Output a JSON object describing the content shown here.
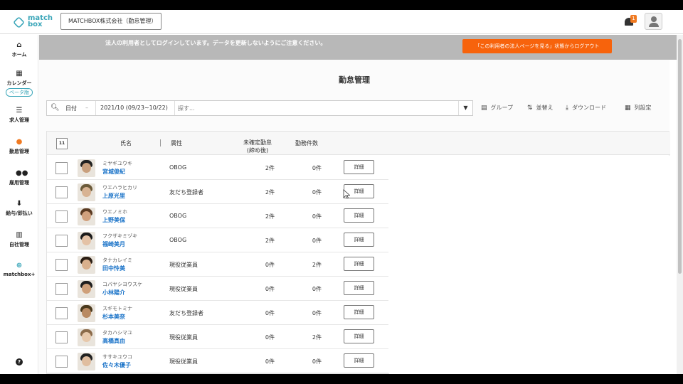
{
  "header": {
    "logo_text": "match\nbox",
    "company": "MATCHBOX株式会社（勤怠管理）",
    "notification_count": "1"
  },
  "sidebar": {
    "items": [
      {
        "icon": "home-icon",
        "label": "ホーム"
      },
      {
        "icon": "calendar-icon",
        "label": "カレンダー",
        "badge": "ベータ版"
      },
      {
        "icon": "list-icon",
        "label": "求人管理"
      },
      {
        "icon": "attendance-icon",
        "label": "勤怠管理"
      },
      {
        "icon": "people-icon",
        "label": "雇用管理"
      },
      {
        "icon": "payment-icon",
        "label": "給与/即払い"
      },
      {
        "icon": "building-icon",
        "label": "自社管理"
      },
      {
        "icon": "plus-circle-icon",
        "label": "matchbox+"
      }
    ],
    "help": "?"
  },
  "notice": {
    "text": "法人の利用者としてログインしています。データを更新しないようにご注意ください。",
    "button": "「この利用者の法人ページを見る」状態からログアウト"
  },
  "page": {
    "title": "勤怠管理"
  },
  "search": {
    "date_label": "日付",
    "date_value": "2021/10 (09/23~10/22)",
    "placeholder": "探す..."
  },
  "toolbar": {
    "group": "グループ",
    "sort": "並替え",
    "download": "ダウンロード",
    "columns": "列設定"
  },
  "table": {
    "select_count": "11",
    "headers": {
      "name": "氏名",
      "attribute": "属性",
      "pending": "未確定勤怠\n(締め後)",
      "count": "勤務件数"
    },
    "detail_label": "詳細",
    "rows": [
      {
        "kana": "ミヤギユウキ",
        "name": "宮城俊紀",
        "attribute": "OBOG",
        "pending": "2件",
        "count": "0件",
        "hair": "#222",
        "skin": "#c9a07e"
      },
      {
        "kana": "ウエハラヒカリ",
        "name": "上原光里",
        "attribute": "友だち登録者",
        "pending": "2件",
        "count": "0件",
        "hair": "#6b5a3a",
        "skin": "#d8b393"
      },
      {
        "kana": "ウエノミホ",
        "name": "上野美保",
        "attribute": "OBOG",
        "pending": "2件",
        "count": "0件",
        "hair": "#5a3a22",
        "skin": "#d1a17e"
      },
      {
        "kana": "フクザキミヅキ",
        "name": "福崎美月",
        "attribute": "OBOG",
        "pending": "2件",
        "count": "0件",
        "hair": "#1b1b1b",
        "skin": "#e4c2a6"
      },
      {
        "kana": "タナカレイミ",
        "name": "田中怜美",
        "attribute": "現役従業員",
        "pending": "0件",
        "count": "2件",
        "hair": "#2b1e14",
        "skin": "#d9b08d"
      },
      {
        "kana": "コバヤシヨウスケ",
        "name": "小林陽介",
        "attribute": "現役従業員",
        "pending": "0件",
        "count": "0件",
        "hair": "#1e1e1e",
        "skin": "#cfa07a"
      },
      {
        "kana": "スギモトミナ",
        "name": "杉本美奈",
        "attribute": "友だち登録者",
        "pending": "0件",
        "count": "0件",
        "hair": "#4a3a1e",
        "skin": "#b98a62"
      },
      {
        "kana": "タカハシマユ",
        "name": "高橋真由",
        "attribute": "現役従業員",
        "pending": "0件",
        "count": "2件",
        "hair": "#8a6a4a",
        "skin": "#e7c8ab"
      },
      {
        "kana": "ササキユウコ",
        "name": "佐々木優子",
        "attribute": "現役従業員",
        "pending": "0件",
        "count": "0件",
        "hair": "#222",
        "skin": "#e0bea0"
      }
    ]
  },
  "colors": {
    "brand": "#3aa6b9",
    "notice_bg": "#b8b8b8",
    "logout_button": "#f7630c",
    "link": "#1a73c8",
    "badge": "#f07a22"
  }
}
